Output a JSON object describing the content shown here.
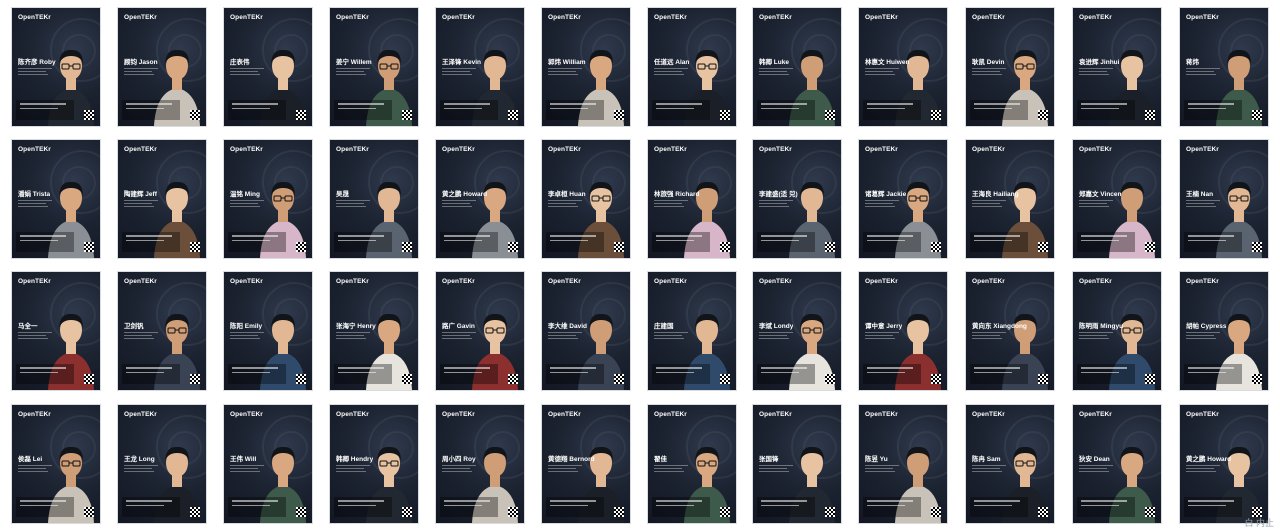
{
  "brand": "OpenTEKr",
  "watermark": "白 内止",
  "colors": {
    "card_bg": "#1c2331",
    "text": "#ffffff",
    "page_bg": "#ffffff"
  },
  "rows": [
    [
      {
        "name": "陈齐彦 Roby"
      },
      {
        "name": "顾钧 Jason"
      },
      {
        "name": "庄表伟"
      },
      {
        "name": "姜宁 Willem"
      },
      {
        "name": "王泽锋 Kevin"
      },
      {
        "name": "郭炜 William"
      },
      {
        "name": "任道远 Alan"
      },
      {
        "name": "韩卿 Luke"
      },
      {
        "name": "林惠文 Huiwen"
      },
      {
        "name": "耿凯 Devin"
      },
      {
        "name": "袁进辉 Jinhui"
      },
      {
        "name": "蒋炜"
      }
    ],
    [
      {
        "name": "潘娟 Trista"
      },
      {
        "name": "陶建辉 Jeff"
      },
      {
        "name": "温铭 Ming"
      },
      {
        "name": "吴晟"
      },
      {
        "name": "黄之鹏 Howard"
      },
      {
        "name": "李卓桓 Huan"
      },
      {
        "name": "林旅强 Richard"
      },
      {
        "name": "李建盛(适 兕)"
      },
      {
        "name": "诸葛辉 Jackie"
      },
      {
        "name": "王海良 Hailiang"
      },
      {
        "name": "郑嘉文 Vincen"
      },
      {
        "name": "王楠 Nan"
      }
    ],
    [
      {
        "name": "马全一"
      },
      {
        "name": "卫剑钒"
      },
      {
        "name": "陈阳 Emily"
      },
      {
        "name": "张海宁 Henry"
      },
      {
        "name": "路广 Gavin"
      },
      {
        "name": "李大维 David"
      },
      {
        "name": "庄建国"
      },
      {
        "name": "李斌 Londy"
      },
      {
        "name": "谭中意 Jerry"
      },
      {
        "name": "黄向东 Xiangdong"
      },
      {
        "name": "陈明雨 Mingyu"
      },
      {
        "name": "胡帕 Cypress"
      }
    ],
    [
      {
        "name": "侯磊 Lei"
      },
      {
        "name": "王龙 Long"
      },
      {
        "name": "王伟 Will"
      },
      {
        "name": "韩卿 Hendry"
      },
      {
        "name": "周小四 Roy"
      },
      {
        "name": "黄德翔 Bernord"
      },
      {
        "name": "翟佳"
      },
      {
        "name": "张国锋"
      },
      {
        "name": "陈昱 Yu"
      },
      {
        "name": "陈冉 Sam"
      },
      {
        "name": "狄安 Dean"
      },
      {
        "name": "黄之鹏 Howard"
      }
    ]
  ]
}
